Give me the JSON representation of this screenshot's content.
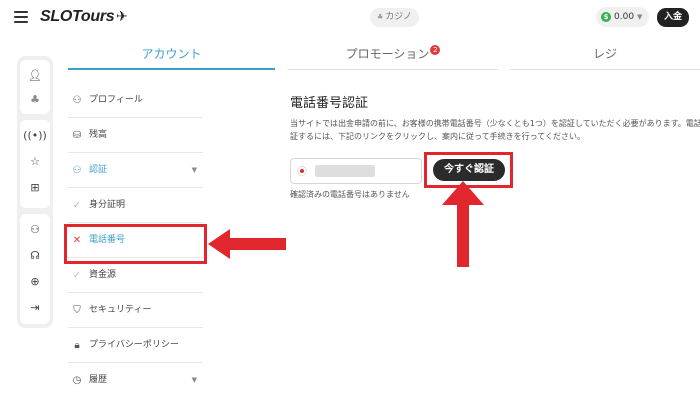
{
  "header": {
    "logo": "SLOTours",
    "casino_label": "カジノ",
    "balance": "0.00",
    "deposit_label": "入金"
  },
  "tabs": [
    {
      "label": "アカウント"
    },
    {
      "label": "プロモーション",
      "badge": "2"
    },
    {
      "label": "レジ"
    }
  ],
  "menu": {
    "items": [
      {
        "label": "プロフィール"
      },
      {
        "label": "残高"
      },
      {
        "label": "認証"
      },
      {
        "label": "身分証明"
      },
      {
        "label": "電話番号"
      },
      {
        "label": "資金源"
      },
      {
        "label": "セキュリティー"
      },
      {
        "label": "プライバシーポリシー"
      },
      {
        "label": "履歴"
      }
    ]
  },
  "main": {
    "title": "電話番号認証",
    "description_line1": "当サイトでは出金申請の前に、お客様の携帯電話番号（少なくとも1つ）を認証していただく必要があります。電話番号",
    "description_line2": "証するには、下記のリンクをクリックし、案内に従って手続きを行ってください。",
    "verify_button": "今すぐ認証",
    "no_verified_text": "確認済みの電話番号はありません"
  },
  "colors": {
    "accent": "#3aa0c9",
    "highlight": "#e2262e",
    "badge": "#e23a3a",
    "button_dark": "#2b2b2b"
  },
  "icons": [
    "menu-icon",
    "plane-icon",
    "user-icon",
    "coin-icon",
    "broadcast-icon",
    "star-icon",
    "gift-icon",
    "support-icon",
    "globe-icon",
    "logout-icon",
    "wallet-icon",
    "shield-icon",
    "lock-icon",
    "clock-icon",
    "check-icon",
    "close-icon"
  ]
}
